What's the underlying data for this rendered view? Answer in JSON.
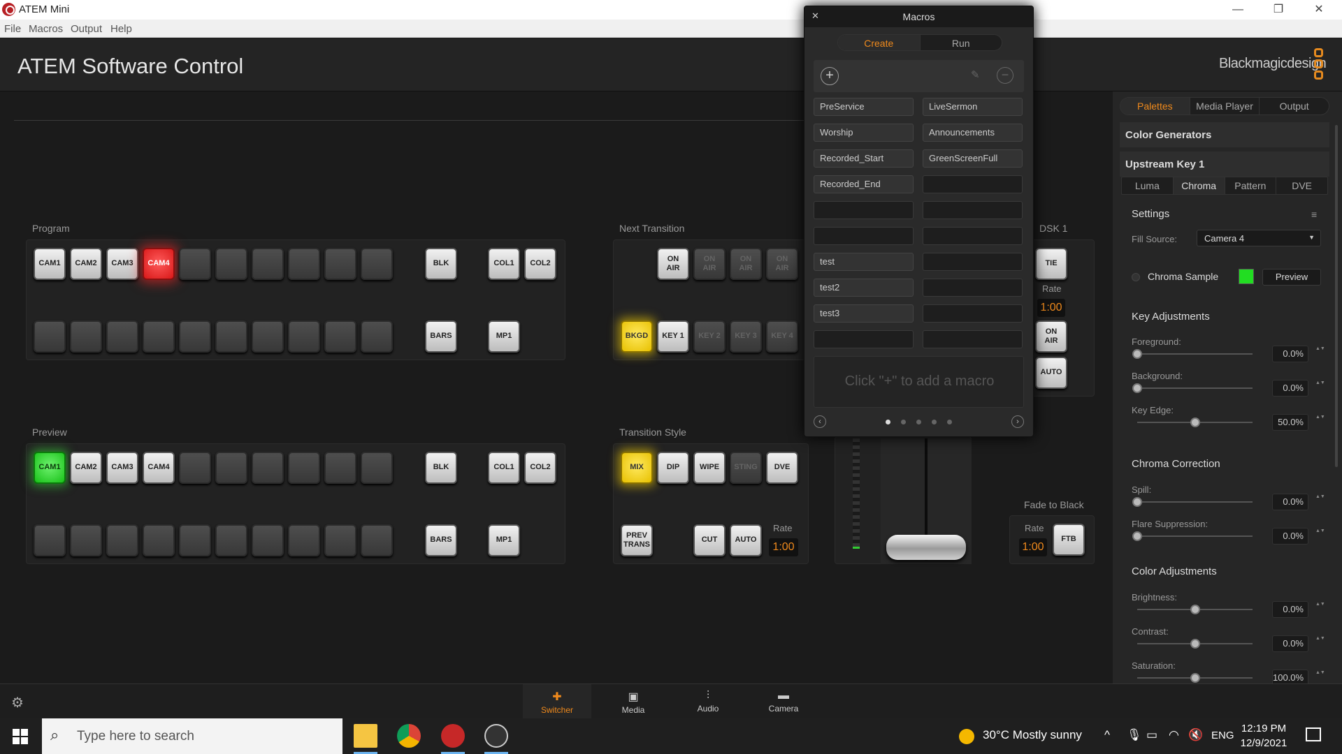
{
  "window": {
    "title": "ATEM Mini",
    "minimize": "—",
    "restore": "❐",
    "close": "✕"
  },
  "menu": [
    "File",
    "Macros",
    "Output",
    "Help"
  ],
  "app": {
    "title": "ATEM Software Control",
    "brand": "Blackmagicdesign"
  },
  "program": {
    "label": "Program",
    "top_row": [
      "CAM1",
      "CAM2",
      "CAM3",
      "CAM4",
      "",
      "",
      "",
      "",
      "",
      ""
    ],
    "active": "CAM4",
    "blk": "BLK",
    "col1": "COL1",
    "col2": "COL2",
    "bars": "BARS",
    "mp1": "MP1"
  },
  "preview": {
    "label": "Preview",
    "top_row": [
      "CAM1",
      "CAM2",
      "CAM3",
      "CAM4",
      "",
      "",
      "",
      "",
      "",
      ""
    ],
    "active": "CAM1",
    "blk": "BLK",
    "col1": "COL1",
    "col2": "COL2",
    "bars": "BARS",
    "mp1": "MP1"
  },
  "next_transition": {
    "label": "Next Transition",
    "on_air": [
      "ON\nAIR",
      "ON\nAIR",
      "ON\nAIR",
      "ON\nAIR"
    ],
    "layers": [
      "BKGD",
      "KEY 1",
      "KEY 2",
      "KEY 3",
      "KEY 4"
    ]
  },
  "transition_style": {
    "label": "Transition Style",
    "styles": [
      "MIX",
      "DIP",
      "WIPE",
      "STING",
      "DVE"
    ],
    "prev_trans": "PREV\nTRANS",
    "cut": "CUT",
    "auto": "AUTO",
    "rate_label": "Rate",
    "rate": "1:00"
  },
  "dsk": {
    "label": "DSK 1",
    "tie": "TIE",
    "rate_label": "Rate",
    "rate": "1:00",
    "on_air": "ON\nAIR",
    "auto": "AUTO"
  },
  "ftb": {
    "label": "Fade to Black",
    "rate_label": "Rate",
    "rate": "1:00",
    "button": "FTB"
  },
  "macros": {
    "title": "Macros",
    "tabs": [
      "Create",
      "Run"
    ],
    "active_tab": "Create",
    "left": [
      "PreService",
      "Worship",
      "Recorded_Start",
      "Recorded_End",
      "",
      "",
      "test",
      "test2",
      "test3",
      ""
    ],
    "right": [
      "LiveSermon",
      "Announcements",
      "GreenScreenFull",
      "",
      "",
      "",
      "",
      "",
      "",
      ""
    ],
    "hint": "Click \"+\" to add a macro",
    "pages": 5,
    "current_page": 1
  },
  "sidebar": {
    "tabs": [
      "Palettes",
      "Media Player",
      "Output"
    ],
    "active_tab": "Palettes",
    "color_generators": "Color Generators",
    "upstream_key": "Upstream Key 1",
    "key_tabs": [
      "Luma",
      "Chroma",
      "Pattern",
      "DVE"
    ],
    "active_key_tab": "Chroma",
    "settings": "Settings",
    "fill_source_label": "Fill Source:",
    "fill_source": "Camera 4",
    "chroma_sample": "Chroma Sample",
    "chroma_color": "#22dd22",
    "preview_btn": "Preview",
    "key_adjustments": "Key Adjustments",
    "foreground_label": "Foreground:",
    "foreground": "0.0%",
    "background_label": "Background:",
    "background": "0.0%",
    "key_edge_label": "Key Edge:",
    "key_edge": "50.0%",
    "chroma_correction": "Chroma Correction",
    "spill_label": "Spill:",
    "spill": "0.0%",
    "flare_label": "Flare Suppression:",
    "flare": "0.0%",
    "color_adjustments": "Color Adjustments",
    "brightness_label": "Brightness:",
    "brightness": "0.0%",
    "contrast_label": "Contrast:",
    "contrast": "0.0%",
    "saturation_label": "Saturation:",
    "saturation": "100.0%"
  },
  "bottom_nav": [
    "Switcher",
    "Media",
    "Audio",
    "Camera"
  ],
  "active_nav": "Switcher",
  "taskbar": {
    "search_placeholder": "Type here to search",
    "weather": "30°C  Mostly sunny",
    "lang": "ENG",
    "time": "12:19 PM",
    "date": "12/9/2021"
  },
  "colors": {
    "accent": "#f08a1c",
    "program": "#e02020",
    "preview": "#20c020",
    "transition": "#f0d000"
  }
}
